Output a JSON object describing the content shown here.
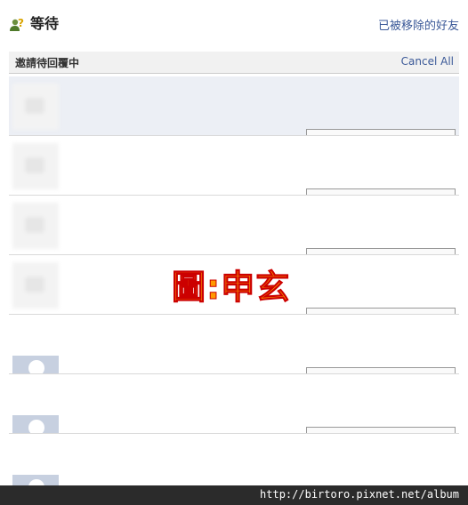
{
  "header": {
    "title": "等待",
    "removed_friends_link": "已被移除的好友",
    "icon": "pending-requests-icon"
  },
  "pending_bar": {
    "title": "邀請待回覆中",
    "cancel_all": "Cancel All"
  },
  "requests": [
    {
      "avatar": "blurred-photo",
      "highlighted": true
    },
    {
      "avatar": "blurred-photo",
      "highlighted": false
    },
    {
      "avatar": "blurred-photo",
      "highlighted": false
    },
    {
      "avatar": "blurred-photo",
      "highlighted": false
    },
    {
      "avatar": "default-silhouette",
      "highlighted": false
    },
    {
      "avatar": "default-silhouette",
      "highlighted": false
    },
    {
      "avatar": "default-silhouette",
      "highlighted": false
    }
  ],
  "watermark": "圖:申玄",
  "footer": {
    "url": "http://birtoro.pixnet.net/album"
  },
  "colors": {
    "link": "#3b5998",
    "highlight_row": "#eceff5",
    "watermark": "#ff9900"
  }
}
